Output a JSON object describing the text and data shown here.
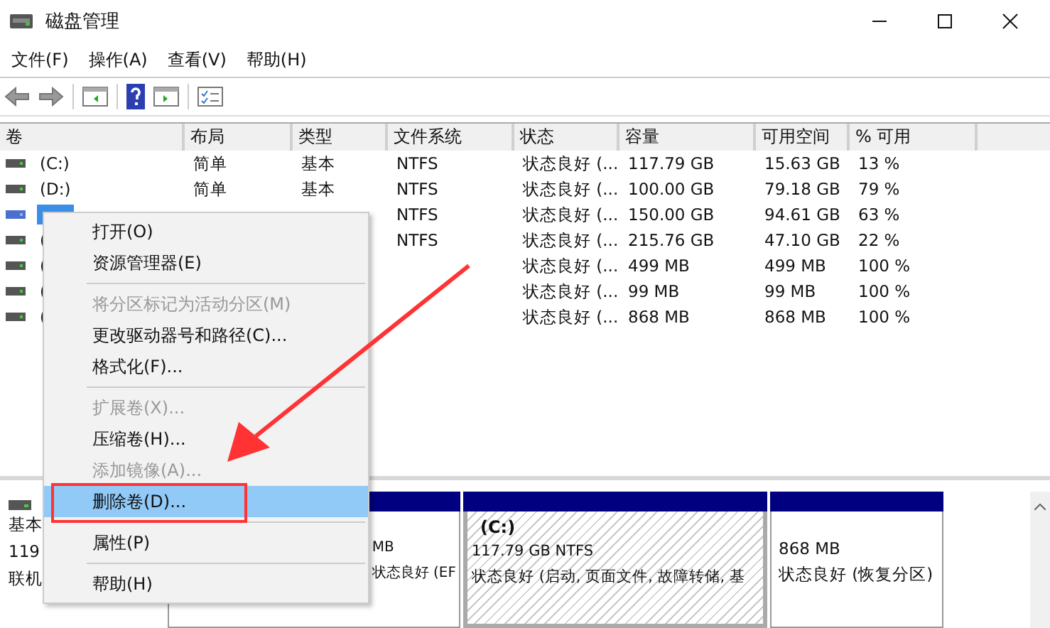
{
  "window": {
    "title": "磁盘管理"
  },
  "menu": [
    "文件(F)",
    "操作(A)",
    "查看(V)",
    "帮助(H)"
  ],
  "table": {
    "columns": [
      "卷",
      "布局",
      "类型",
      "文件系统",
      "状态",
      "容量",
      "可用空间",
      "% 可用"
    ],
    "rows": [
      {
        "selected": false,
        "volume": "(C:)",
        "layout": "简单",
        "type": "基本",
        "fs": "NTFS",
        "status": "状态良好 (...",
        "capacity": "117.79 GB",
        "free": "15.63 GB",
        "percent": "13 %"
      },
      {
        "selected": false,
        "volume": "(D:)",
        "layout": "简单",
        "type": "基本",
        "fs": "NTFS",
        "status": "状态良好 (...",
        "capacity": "100.00 GB",
        "free": "79.18 GB",
        "percent": "79 %"
      },
      {
        "selected": true,
        "fs": "NTFS",
        "status": "状态良好 (...",
        "capacity": "150.00 GB",
        "free": "94.61 GB",
        "percent": "63 %"
      },
      {
        "selected": false,
        "volume": "(",
        "fs": "NTFS",
        "status": "状态良好 (...",
        "capacity": "215.76 GB",
        "free": "47.10 GB",
        "percent": "22 %"
      },
      {
        "selected": false,
        "volume": "(",
        "status": "状态良好 (...",
        "capacity": "499 MB",
        "free": "499 MB",
        "percent": "100 %"
      },
      {
        "selected": false,
        "volume": "(",
        "status": "状态良好 (...",
        "capacity": "99 MB",
        "free": "99 MB",
        "percent": "100 %"
      },
      {
        "selected": false,
        "volume": "(",
        "status": "状态良好 (...",
        "capacity": "868 MB",
        "free": "868 MB",
        "percent": "100 %"
      }
    ]
  },
  "disk": {
    "lines": [
      "基本",
      "119",
      "联机"
    ],
    "partitions": [
      {
        "kind": "hidden",
        "lines": [
          "MB",
          "状态良好 (EF"
        ]
      },
      {
        "kind": "hatched",
        "name": "(C:)",
        "lines": [
          "117.79 GB NTFS",
          "状态良好 (启动, 页面文件, 故障转储, 基"
        ]
      },
      {
        "kind": "plain",
        "lines": [
          "868 MB",
          "状态良好 (恢复分区)"
        ]
      }
    ]
  },
  "context_menu": [
    {
      "kind": "item",
      "label": "打开(O)",
      "disabled": false,
      "selected": false
    },
    {
      "kind": "item",
      "label": "资源管理器(E)",
      "disabled": false,
      "selected": false
    },
    {
      "kind": "separator"
    },
    {
      "kind": "item",
      "label": "将分区标记为活动分区(M)",
      "disabled": true,
      "selected": false
    },
    {
      "kind": "item",
      "label": "更改驱动器号和路径(C)...",
      "disabled": false,
      "selected": false
    },
    {
      "kind": "item",
      "label": "格式化(F)...",
      "disabled": false,
      "selected": false
    },
    {
      "kind": "separator"
    },
    {
      "kind": "item",
      "label": "扩展卷(X)...",
      "disabled": true,
      "selected": false
    },
    {
      "kind": "item",
      "label": "压缩卷(H)...",
      "disabled": false,
      "selected": false
    },
    {
      "kind": "item",
      "label": "添加镜像(A)...",
      "disabled": true,
      "selected": false
    },
    {
      "kind": "item",
      "label": "删除卷(D)...",
      "disabled": false,
      "selected": true
    },
    {
      "kind": "separator"
    },
    {
      "kind": "item",
      "label": "属性(P)",
      "disabled": false,
      "selected": false
    },
    {
      "kind": "separator"
    },
    {
      "kind": "item",
      "label": "帮助(H)",
      "disabled": false,
      "selected": false
    }
  ]
}
